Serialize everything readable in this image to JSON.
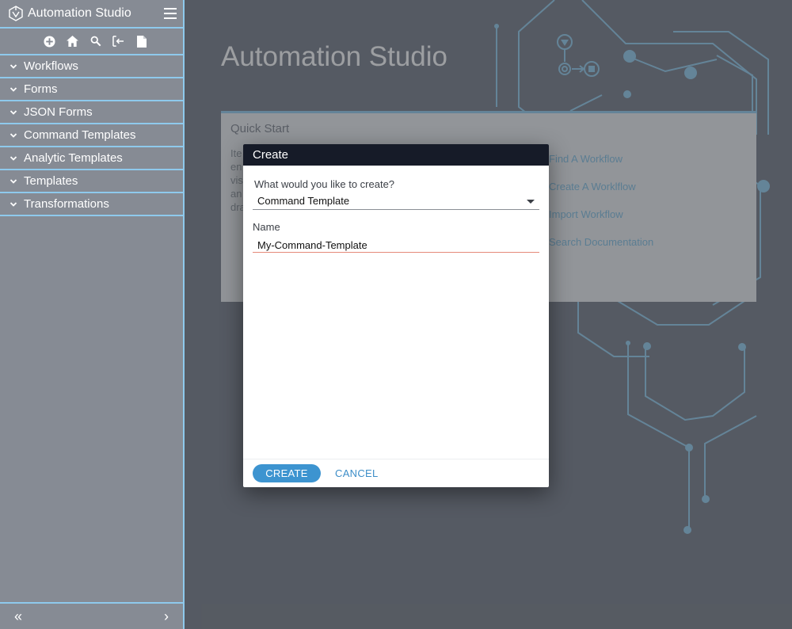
{
  "app": {
    "title": "Automation Studio"
  },
  "sidebar": {
    "title": "Automation Studio",
    "tools": [
      "add-icon",
      "home-icon",
      "search-icon",
      "import-icon",
      "document-icon"
    ],
    "items": [
      {
        "label": "Workflows"
      },
      {
        "label": "Forms"
      },
      {
        "label": "JSON Forms"
      },
      {
        "label": "Command Templates"
      },
      {
        "label": "Analytic Templates"
      },
      {
        "label": "Templates"
      },
      {
        "label": "Transformations"
      }
    ],
    "footer": {
      "collapse": "«",
      "expand": "›"
    }
  },
  "main": {
    "title": "Automation Studio",
    "quick_start": {
      "title": "Quick Start",
      "text_lines": [
        "Ite",
        "en",
        "vis",
        "an",
        "dra"
      ],
      "links": [
        "Find A Workflow",
        "Create A Worklflow",
        "Import Workflow",
        "Search Documentation"
      ]
    }
  },
  "dialog": {
    "title": "Create",
    "question": "What would you like to create?",
    "selected_type": "Command Template",
    "name_label": "Name",
    "name_value": "My-Command-Template",
    "create_label": "CREATE",
    "cancel_label": "CANCEL"
  },
  "colors": {
    "accent": "#3d94d0",
    "sidebar_line": "#8ec9ec",
    "dialog_header": "#161b28"
  }
}
